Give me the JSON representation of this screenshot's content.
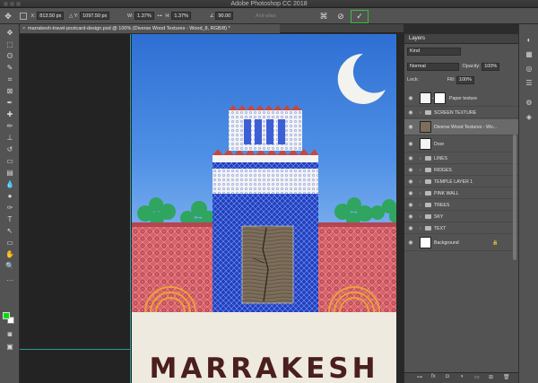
{
  "app": {
    "title": "Adobe Photoshop CC 2018"
  },
  "options": {
    "x_label": "X:",
    "x_value": "813.50 px",
    "y_label": "Y:",
    "y_value": "1097.50 px",
    "w_label": "W:",
    "w_value": "1.37%",
    "h_label": "H:",
    "h_value": "1.37%",
    "angle_value": "90.00",
    "antialias_label": "Anti-alias"
  },
  "document": {
    "tab_title": "marrakesh-travel-postcard-design.psd @ 100% (Diverse Wood Textures - Wood_8, RGB/8) *"
  },
  "artwork": {
    "title": "MARRAKESH"
  },
  "layers_panel": {
    "title": "Layers",
    "search_placeholder": "Kind",
    "blend_mode": "Normal",
    "opacity_label": "Opacity:",
    "opacity_value": "100%",
    "lock_label": "Lock:",
    "fill_label": "Fill:",
    "fill_value": "100%",
    "layers": [
      {
        "name": "Paper texture"
      },
      {
        "name": "SCREEN TEXTURE"
      },
      {
        "name": "Diverse Wood Textures - Wo..."
      },
      {
        "name": "Door"
      },
      {
        "name": "LINES"
      },
      {
        "name": "RIDGES"
      },
      {
        "name": "TEMPLE LAYER 1"
      },
      {
        "name": "PINK WALL"
      },
      {
        "name": "TREES"
      },
      {
        "name": "SKY"
      },
      {
        "name": "TEXT"
      },
      {
        "name": "Background"
      }
    ]
  },
  "colors": {
    "foreground": "#00e000",
    "background": "#ffffff",
    "commit_outline": "#3cbf3c"
  }
}
